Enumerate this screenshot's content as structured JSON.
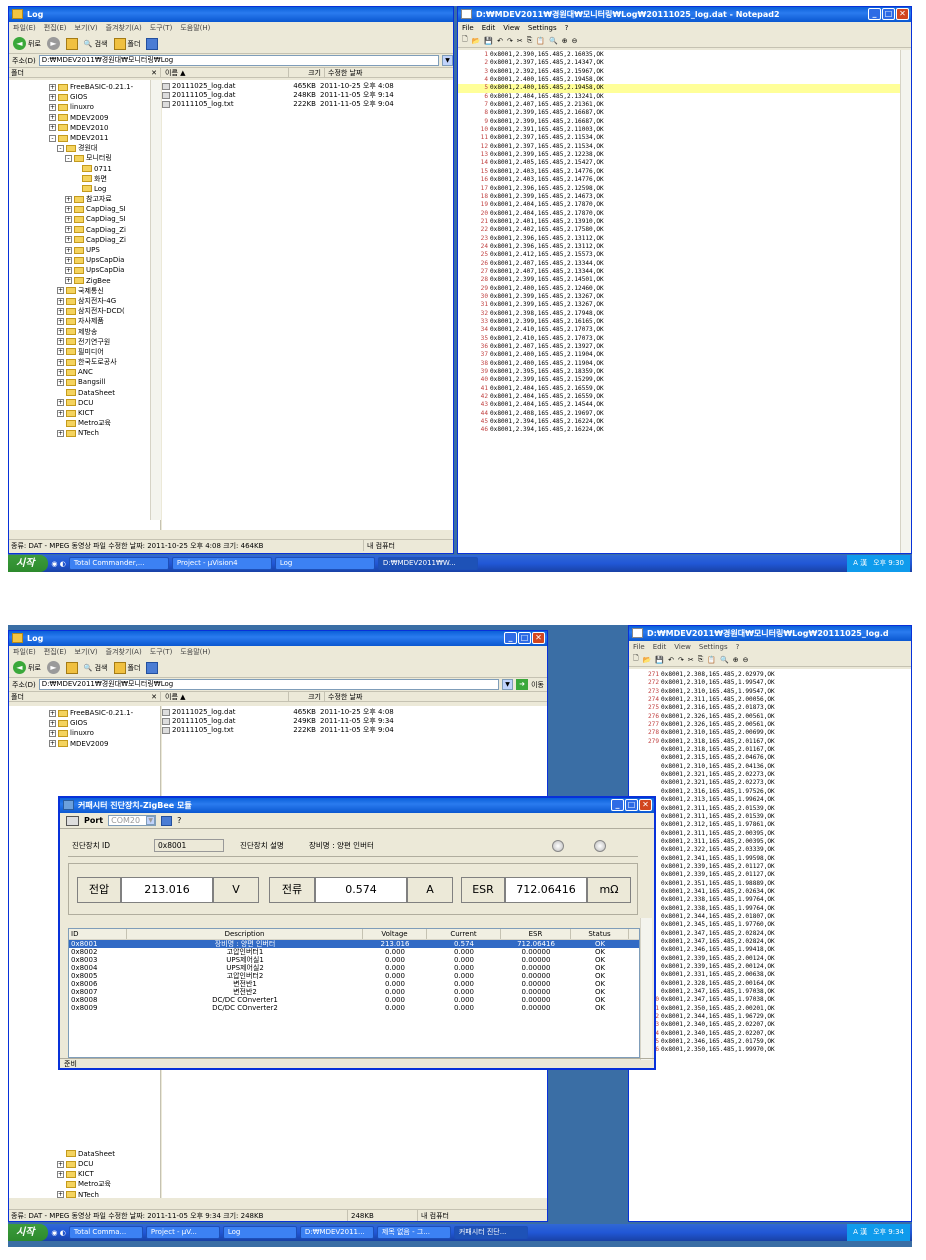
{
  "s1": {
    "explorer": {
      "title": "Log",
      "menu": [
        "파일(E)",
        "편집(E)",
        "보기(V)",
        "즐겨찾기(A)",
        "도구(T)",
        "도움말(H)"
      ],
      "back": "뒤로",
      "search": "검색",
      "folders": "폴더",
      "address_label": "주소(D)",
      "address": "D:₩MDEV2011₩경원대₩모니터링₩Log",
      "folders_header": "폴더",
      "col_name": "이름 ▲",
      "col_size": "크기",
      "col_date": "수정한 날짜",
      "tree": [
        {
          "label": "FreeBASIC-0.21.1-",
          "pm": "+",
          "indent": 0
        },
        {
          "label": "GIOS",
          "pm": "+",
          "indent": 0
        },
        {
          "label": "linuxro",
          "pm": "+",
          "indent": 0
        },
        {
          "label": "MDEV2009",
          "pm": "+",
          "indent": 0
        },
        {
          "label": "MDEV2010",
          "pm": "+",
          "indent": 0
        },
        {
          "label": "MDEV2011",
          "pm": "-",
          "indent": 0
        },
        {
          "label": "경원대",
          "pm": "-",
          "indent": 1
        },
        {
          "label": "모니터링",
          "pm": "-",
          "indent": 2
        },
        {
          "label": "0711",
          "pm": "",
          "indent": 3
        },
        {
          "label": "화면",
          "pm": "",
          "indent": 3
        },
        {
          "label": "Log",
          "pm": "",
          "indent": 3
        },
        {
          "label": "참고자료",
          "pm": "+",
          "indent": 2
        },
        {
          "label": "CapDiag_SI",
          "pm": "+",
          "indent": 2
        },
        {
          "label": "CapDiag_SI",
          "pm": "+",
          "indent": 2
        },
        {
          "label": "CapDiag_Zi",
          "pm": "+",
          "indent": 2
        },
        {
          "label": "CapDiag_Zi",
          "pm": "+",
          "indent": 2
        },
        {
          "label": "UPS",
          "pm": "+",
          "indent": 2
        },
        {
          "label": "UpsCapDia",
          "pm": "+",
          "indent": 2
        },
        {
          "label": "UpsCapDia",
          "pm": "+",
          "indent": 2
        },
        {
          "label": "ZigBee",
          "pm": "+",
          "indent": 2
        },
        {
          "label": "국제통신",
          "pm": "+",
          "indent": 1
        },
        {
          "label": "삼지전자-4G",
          "pm": "+",
          "indent": 1
        },
        {
          "label": "삼지전자-DCD(",
          "pm": "+",
          "indent": 1
        },
        {
          "label": "자사제품",
          "pm": "+",
          "indent": 1
        },
        {
          "label": "제방송",
          "pm": "+",
          "indent": 1
        },
        {
          "label": "전기연구원",
          "pm": "+",
          "indent": 1
        },
        {
          "label": "필미디어",
          "pm": "+",
          "indent": 1
        },
        {
          "label": "한국도로공사",
          "pm": "+",
          "indent": 1
        },
        {
          "label": "ANC",
          "pm": "+",
          "indent": 1
        },
        {
          "label": "Bangsill",
          "pm": "+",
          "indent": 1
        },
        {
          "label": "DataSheet",
          "pm": "",
          "indent": 1
        },
        {
          "label": "DCU",
          "pm": "+",
          "indent": 1
        },
        {
          "label": "KICT",
          "pm": "+",
          "indent": 1
        },
        {
          "label": "Metro교육",
          "pm": "",
          "indent": 1
        },
        {
          "label": "NTech",
          "pm": "+",
          "indent": 1
        }
      ],
      "files": [
        {
          "name": "20111025_log.dat",
          "size": "465KB",
          "date": "2011-10-25 오후 4:08"
        },
        {
          "name": "20111105_log.dat",
          "size": "248KB",
          "date": "2011-11-05 오후 9:14"
        },
        {
          "name": "20111105_log.txt",
          "size": "222KB",
          "date": "2011-11-05 오후 9:04"
        }
      ],
      "status": "종류: DAT - MPEG 동영상 파일 수정한 날짜: 2011-10-25 오후 4:08 크기: 464KB",
      "status_right": "내 컴퓨터"
    },
    "notepad": {
      "title": "D:₩MDEV2011₩경원대₩모니터링₩Log₩20111025_log.dat - Notepad2",
      "menu": [
        "File",
        "Edit",
        "View",
        "Settings",
        "?"
      ],
      "highlight_line": 5,
      "lines": [
        "1 0x8001,2.390,165.485,2.16035,OK",
        "2 0x8001,2.397,165.485,2.14347,OK",
        "3 0x8001,2.392,165.485,2.15967,OK",
        "4 0x8001,2.400,165.485,2.19458,OK",
        "5 0x8001,2.400,165.485,2.19458,OK",
        "6 0x8001,2.404,165.485,2.13241,OK",
        "7 0x8001,2.407,165.485,2.21361,OK",
        "8 0x8001,2.399,165.485,2.16687,OK",
        "9 0x8001,2.399,165.485,2.16687,OK",
        "10 0x8001,2.391,165.485,2.11003,OK",
        "11 0x8001,2.397,165.485,2.11534,OK",
        "12 0x8001,2.397,165.485,2.11534,OK",
        "13 0x8001,2.399,165.485,2.12238,OK",
        "14 0x8001,2.405,165.485,2.15427,OK",
        "15 0x8001,2.403,165.485,2.14776,OK",
        "16 0x8001,2.403,165.485,2.14776,OK",
        "17 0x8001,2.396,165.485,2.12598,OK",
        "18 0x8001,2.399,165.485,2.14673,OK",
        "19 0x8001,2.404,165.485,2.17870,OK",
        "20 0x8001,2.404,165.485,2.17870,OK",
        "21 0x8001,2.401,165.485,2.13910,OK",
        "22 0x8001,2.402,165.485,2.17580,OK",
        "23 0x8001,2.396,165.485,2.13112,OK",
        "24 0x8001,2.396,165.485,2.13112,OK",
        "25 0x8001,2.412,165.485,2.15573,OK",
        "26 0x8001,2.407,165.485,2.13344,OK",
        "27 0x8001,2.407,165.485,2.13344,OK",
        "28 0x8001,2.399,165.485,2.14501,OK",
        "29 0x8001,2.400,165.485,2.12460,OK",
        "30 0x8001,2.399,165.485,2.13267,OK",
        "31 0x8001,2.399,165.485,2.13267,OK",
        "32 0x8001,2.398,165.485,2.17948,OK",
        "33 0x8001,2.399,165.485,2.16165,OK",
        "34 0x8001,2.410,165.485,2.17073,OK",
        "35 0x8001,2.410,165.485,2.17073,OK",
        "36 0x8001,2.407,165.485,2.13927,OK",
        "37 0x8001,2.400,165.485,2.11904,OK",
        "38 0x8001,2.400,165.485,2.11904,OK",
        "39 0x8001,2.395,165.485,2.18359,OK",
        "40 0x8001,2.399,165.485,2.15299,OK",
        "41 0x8001,2.404,165.485,2.16559,OK",
        "42 0x8001,2.404,165.485,2.16559,OK",
        "43 0x8001,2.404,165.485,2.14544,OK",
        "44 0x8001,2.408,165.485,2.19697,OK",
        "45 0x8001,2.394,165.485,2.16224,OK",
        "46 0x8001,2.394,165.485,2.16224,OK"
      ]
    },
    "taskbar": {
      "start": "시작",
      "items": [
        "Total Commander,...",
        "Project - µVision4",
        "Log",
        "D:₩MDEV2011₩W..."
      ],
      "time": "오후 9:30"
    }
  },
  "s2": {
    "explorer": {
      "title": "Log",
      "menu": [
        "파일(E)",
        "편집(E)",
        "보기(V)",
        "즐겨찾기(A)",
        "도구(T)",
        "도움말(H)"
      ],
      "back": "뒤로",
      "search": "검색",
      "folders": "폴더",
      "address_label": "주소(D)",
      "address": "D:₩MDEV2011₩경원대₩모니터링₩Log",
      "go": "이동",
      "folders_header": "폴더",
      "col_name": "이름 ▲",
      "col_size": "크기",
      "col_date": "수정한 날짜",
      "tree_top": [
        {
          "label": "FreeBASIC-0.21.1-",
          "pm": "+"
        },
        {
          "label": "GIOS",
          "pm": "+"
        },
        {
          "label": "linuxro",
          "pm": "+"
        },
        {
          "label": "MDEV2009",
          "pm": "+"
        }
      ],
      "tree_bottom": [
        {
          "label": "DataSheet",
          "pm": ""
        },
        {
          "label": "DCU",
          "pm": "+"
        },
        {
          "label": "KICT",
          "pm": "+"
        },
        {
          "label": "Metro교육",
          "pm": ""
        },
        {
          "label": "NTech",
          "pm": "+"
        }
      ],
      "files": [
        {
          "name": "20111025_log.dat",
          "size": "465KB",
          "date": "2011-10-25 오후 4:08"
        },
        {
          "name": "20111105_log.dat",
          "size": "249KB",
          "date": "2011-11-05 오후 9:34"
        },
        {
          "name": "20111105_log.txt",
          "size": "222KB",
          "date": "2011-11-05 오후 9:04"
        }
      ],
      "status": "종류: DAT - MPEG 동영상 파일 수정한 날짜: 2011-11-05 오후 9:34 크기: 248KB",
      "status_size": "248KB",
      "status_right": "내 컴퓨터"
    },
    "notepad": {
      "title": "D:₩MDEV2011₩경원대₩모니터링₩Log₩20111025_log.d",
      "menu": [
        "File",
        "Edit",
        "View",
        "Settings",
        "?"
      ],
      "lines": [
        "271 0x8001,2.308,165.485,2.02979,OK",
        "272 0x8001,2.310,165.485,1.99547,OK",
        "273 0x8001,2.310,165.485,1.99547,OK",
        "274 0x8001,2.311,165.485,2.00056,OK",
        "275 0x8001,2.316,165.485,2.01873,OK",
        "276 0x8001,2.326,165.485,2.00561,OK",
        "277 0x8001,2.326,165.485,2.00561,OK",
        "278 0x8001,2.310,165.485,2.00699,OK",
        "279 0x8001,2.318,165.485,2.01167,OK",
        "0x8001,2.318,165.485,2.01167,OK",
        "0x8001,2.315,165.485,2.04676,OK",
        "0x8001,2.310,165.485,2.04136,OK",
        "0x8001,2.321,165.485,2.02273,OK",
        "0x8001,2.321,165.485,2.02273,OK",
        "0x8001,2.316,165.485,1.97526,OK",
        "0x8001,2.313,165.485,1.99624,OK",
        "0x8001,2.311,165.485,2.01539,OK",
        "0x8001,2.311,165.485,2.01539,OK",
        "0x8001,2.312,165.485,1.97861,OK",
        "0x8001,2.311,165.485,2.00395,OK",
        "0x8001,2.311,165.485,2.00395,OK",
        "0x8001,2.322,165.485,2.03339,OK",
        "0x8001,2.341,165.485,1.99598,OK",
        "0x8001,2.339,165.485,2.01127,OK",
        "0x8001,2.339,165.485,2.01127,OK",
        "0x8001,2.351,165.485,1.98889,OK",
        "0x8001,2.341,165.485,2.02634,OK",
        "0x8001,2.338,165.485,1.99764,OK",
        "0x8001,2.338,165.485,1.99764,OK",
        "0x8001,2.344,165.485,2.01807,OK",
        "0x8001,2.345,165.485,1.97760,OK",
        "0x8001,2.347,165.485,2.02824,OK",
        "0x8001,2.347,165.485,2.02824,OK",
        "0x8001,2.346,165.485,1.99418,OK",
        "0x8001,2.339,165.485,2.00124,OK",
        "0x8001,2.339,165.485,2.00124,OK",
        "0x8001,2.331,165.485,2.00638,OK",
        "0x8001,2.328,165.485,2.00164,OK",
        "0x8001,2.347,165.485,1.97038,OK",
        "310 0x8001,2.347,165.485,1.97038,OK",
        "311 0x8001,2.350,165.485,2.00201,OK",
        "312 0x8001,2.344,165.485,1.96729,OK",
        "313 0x8001,2.340,165.485,2.02207,OK",
        "314 0x8001,2.340,165.485,2.02207,OK",
        "315 0x8001,2.346,165.485,2.01759,OK",
        "316 0x8001,2.350,165.485,1.99970,OK"
      ]
    },
    "dialog": {
      "title": "커패시터 진단장치-ZigBee 모듈",
      "port_label": "Port",
      "port_value": "COM20",
      "device_id_label": "진단장치 ID",
      "device_id": "0x8001",
      "device_desc_label": "진단장치 설명",
      "device_desc": "장비명 : 양편 인버터",
      "voltage_label": "전압",
      "voltage": "213.016",
      "voltage_unit": "V",
      "current_label": "전류",
      "current": "0.574",
      "current_unit": "A",
      "esr_label": "ESR",
      "esr": "712.06416",
      "esr_unit": "mΩ",
      "columns": [
        "ID",
        "Description",
        "Voltage",
        "Current",
        "ESR",
        "Status"
      ],
      "rows": [
        [
          "0x8001",
          "장비명 : 양편 인버터",
          "213.016",
          "0.574",
          "712.06416",
          "OK"
        ],
        [
          "0x8002",
          "고압인버터1",
          "0.000",
          "0.000",
          "0.00000",
          "OK"
        ],
        [
          "0x8003",
          "UPS제어실1",
          "0.000",
          "0.000",
          "0.00000",
          "OK"
        ],
        [
          "0x8004",
          "UPS제어실2",
          "0.000",
          "0.000",
          "0.00000",
          "OK"
        ],
        [
          "0x8005",
          "고압인버터2",
          "0.000",
          "0.000",
          "0.00000",
          "OK"
        ],
        [
          "0x8006",
          "변전반1",
          "0.000",
          "0.000",
          "0.00000",
          "OK"
        ],
        [
          "0x8007",
          "변전반2",
          "0.000",
          "0.000",
          "0.00000",
          "OK"
        ],
        [
          "0x8008",
          "DC/DC COnverter1",
          "0.000",
          "0.000",
          "0.00000",
          "OK"
        ],
        [
          "0x8009",
          "DC/DC COnverter2",
          "0.000",
          "0.000",
          "0.00000",
          "OK"
        ]
      ],
      "status": "준비"
    },
    "taskbar": {
      "start": "시작",
      "items": [
        "Total Comma...",
        "Project - µV...",
        "Log",
        "D:₩MDEV2011...",
        "제목 없음 - 그...",
        "커패시터 진단..."
      ],
      "time": "오후 9:34"
    }
  }
}
